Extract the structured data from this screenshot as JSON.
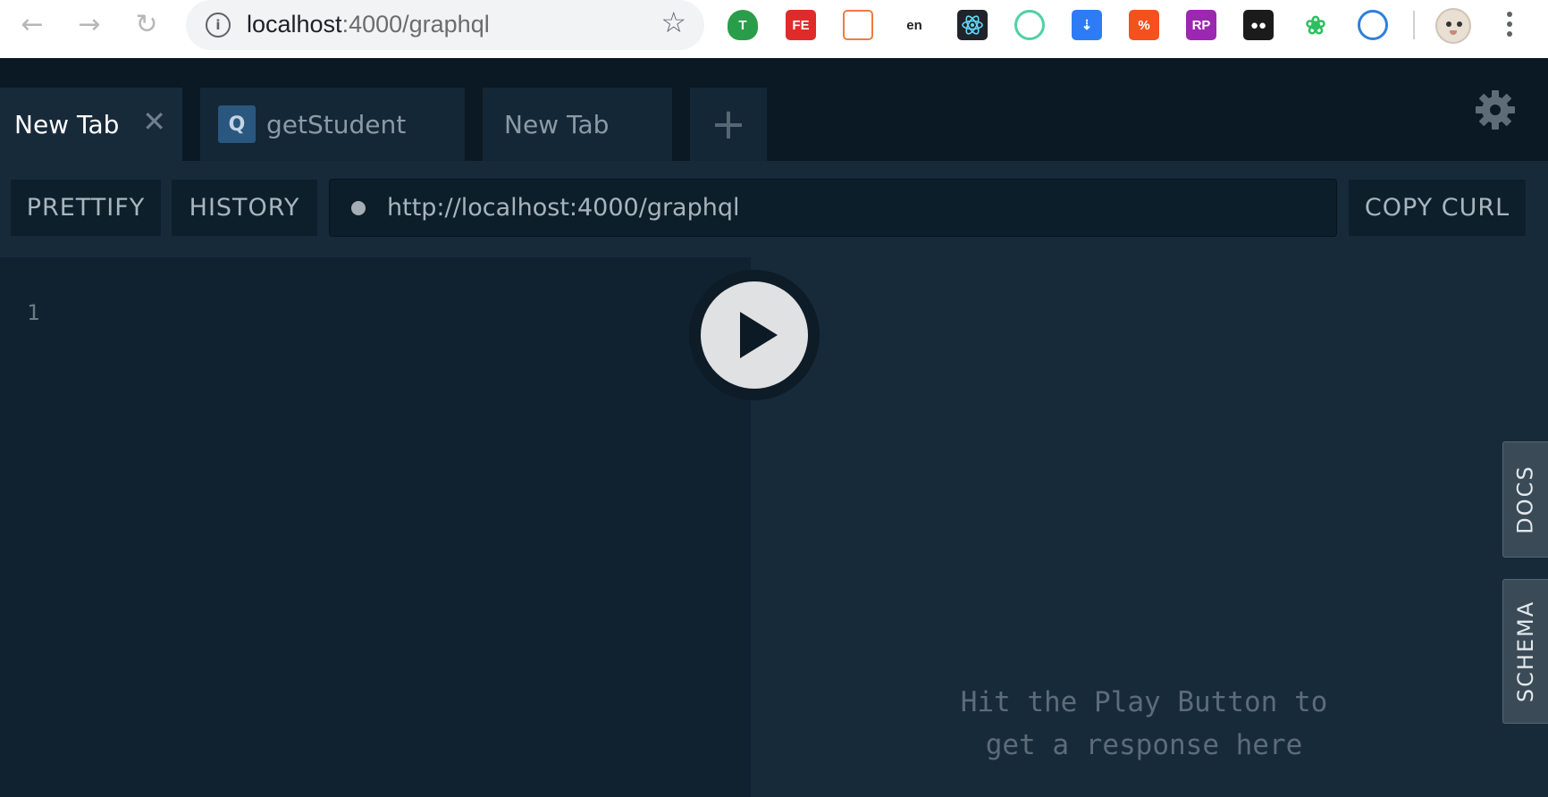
{
  "browser": {
    "url_host": "localhost",
    "url_rest": ":4000/graphql",
    "extensions": [
      "T",
      "FE",
      "",
      "en",
      "",
      "",
      "",
      "",
      "RP",
      "",
      "",
      ""
    ]
  },
  "tabs": [
    {
      "label": "New Tab",
      "active": true
    },
    {
      "label": "getStudent",
      "badge": "Q"
    },
    {
      "label": "New Tab"
    }
  ],
  "toolbar": {
    "prettify": "PRETTIFY",
    "history": "HISTORY",
    "endpoint": "http://localhost:4000/graphql",
    "copy_curl": "COPY CURL"
  },
  "editor": {
    "line_number": "1"
  },
  "result": {
    "hint_line1": "Hit the Play Button to",
    "hint_line2": "get a response here"
  },
  "side_tabs": {
    "docs": "DOCS",
    "schema": "SCHEMA"
  },
  "colors": {
    "background": "#172a3a",
    "tabbar": "#0b1924",
    "editor": "#102230"
  }
}
